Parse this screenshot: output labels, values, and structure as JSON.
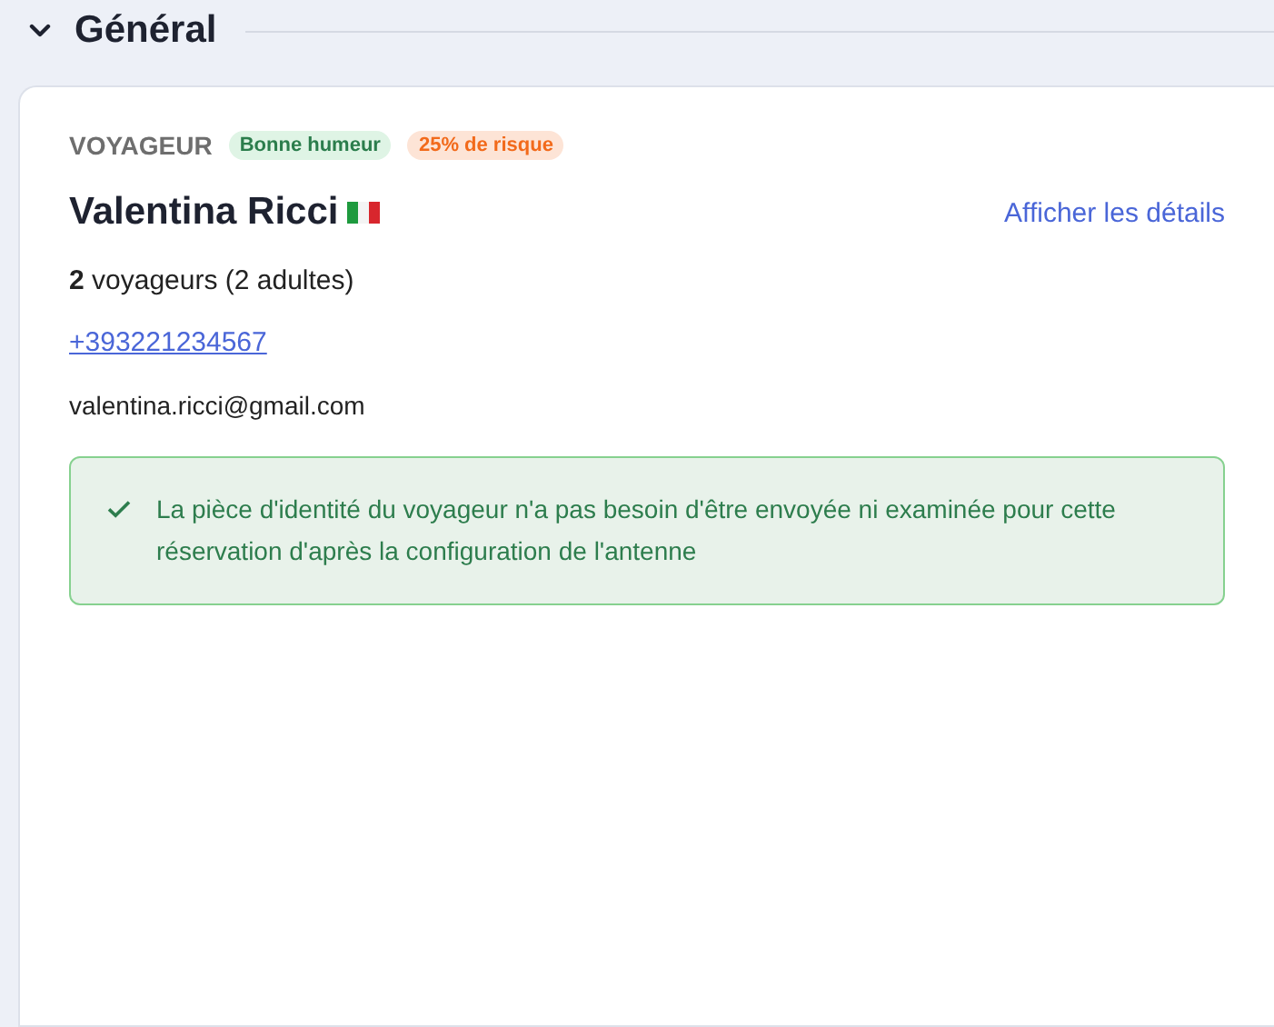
{
  "section": {
    "title": "Général",
    "expanded": true
  },
  "traveler": {
    "label": "VOYAGEUR",
    "badges": [
      {
        "text": "Bonne humeur",
        "kind": "mood"
      },
      {
        "text": "25% de risque",
        "kind": "risk"
      }
    ],
    "name": "Valentina Ricci",
    "details_link": "Afficher les détails",
    "guests": "**2** voyageurs (2 adultes)",
    "phone": "+393221234567",
    "email": "valentina.ricci@gmail.com",
    "notice": {
      "kind": "success",
      "text": "La pièce d'identité du voyageur n'a pas besoin d'être envoyée ni examinée pour cette réservation d'après la configuration de l'antenne"
    }
  }
}
